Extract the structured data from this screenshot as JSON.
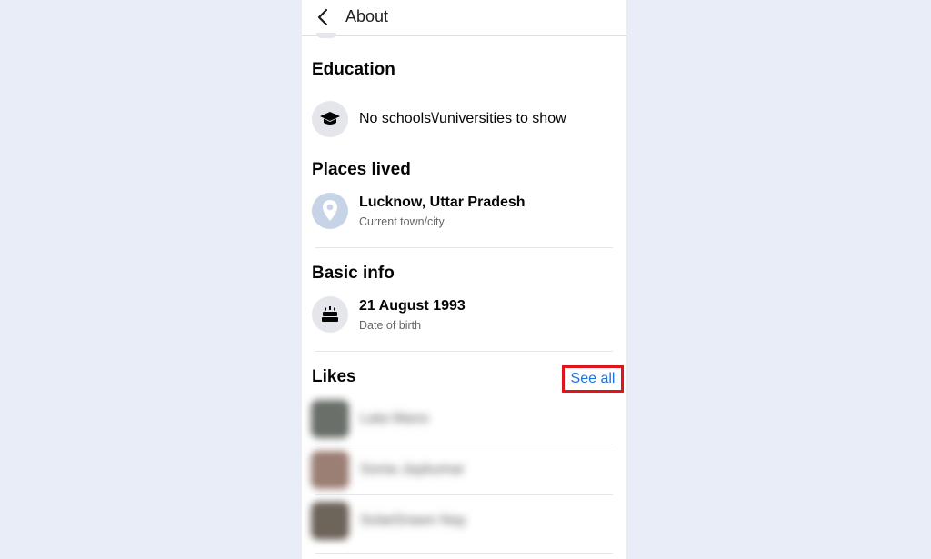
{
  "header": {
    "title": "About"
  },
  "education": {
    "heading": "Education",
    "empty_text": "No schools\\/universities to show"
  },
  "places_lived": {
    "heading": "Places lived",
    "place": "Lucknow, Uttar Pradesh",
    "place_type": "Current town/city"
  },
  "basic_info": {
    "heading": "Basic info",
    "birth_date": "21 August 1993",
    "birth_label": "Date of birth"
  },
  "likes": {
    "heading": "Likes",
    "see_all_label": "See all",
    "items": [
      {
        "name": "Lata Mano",
        "avatar_color": "#6b6f6a"
      },
      {
        "name": "Sonia Jaykumar",
        "avatar_color": "#9b7f74"
      },
      {
        "name": "SolarDrawn Nay",
        "avatar_color": "#6d645a"
      }
    ]
  },
  "colors": {
    "accent": "#1b74e4",
    "highlight_box": "#e0141d",
    "location_icon_bg": "#c7d3e6"
  }
}
